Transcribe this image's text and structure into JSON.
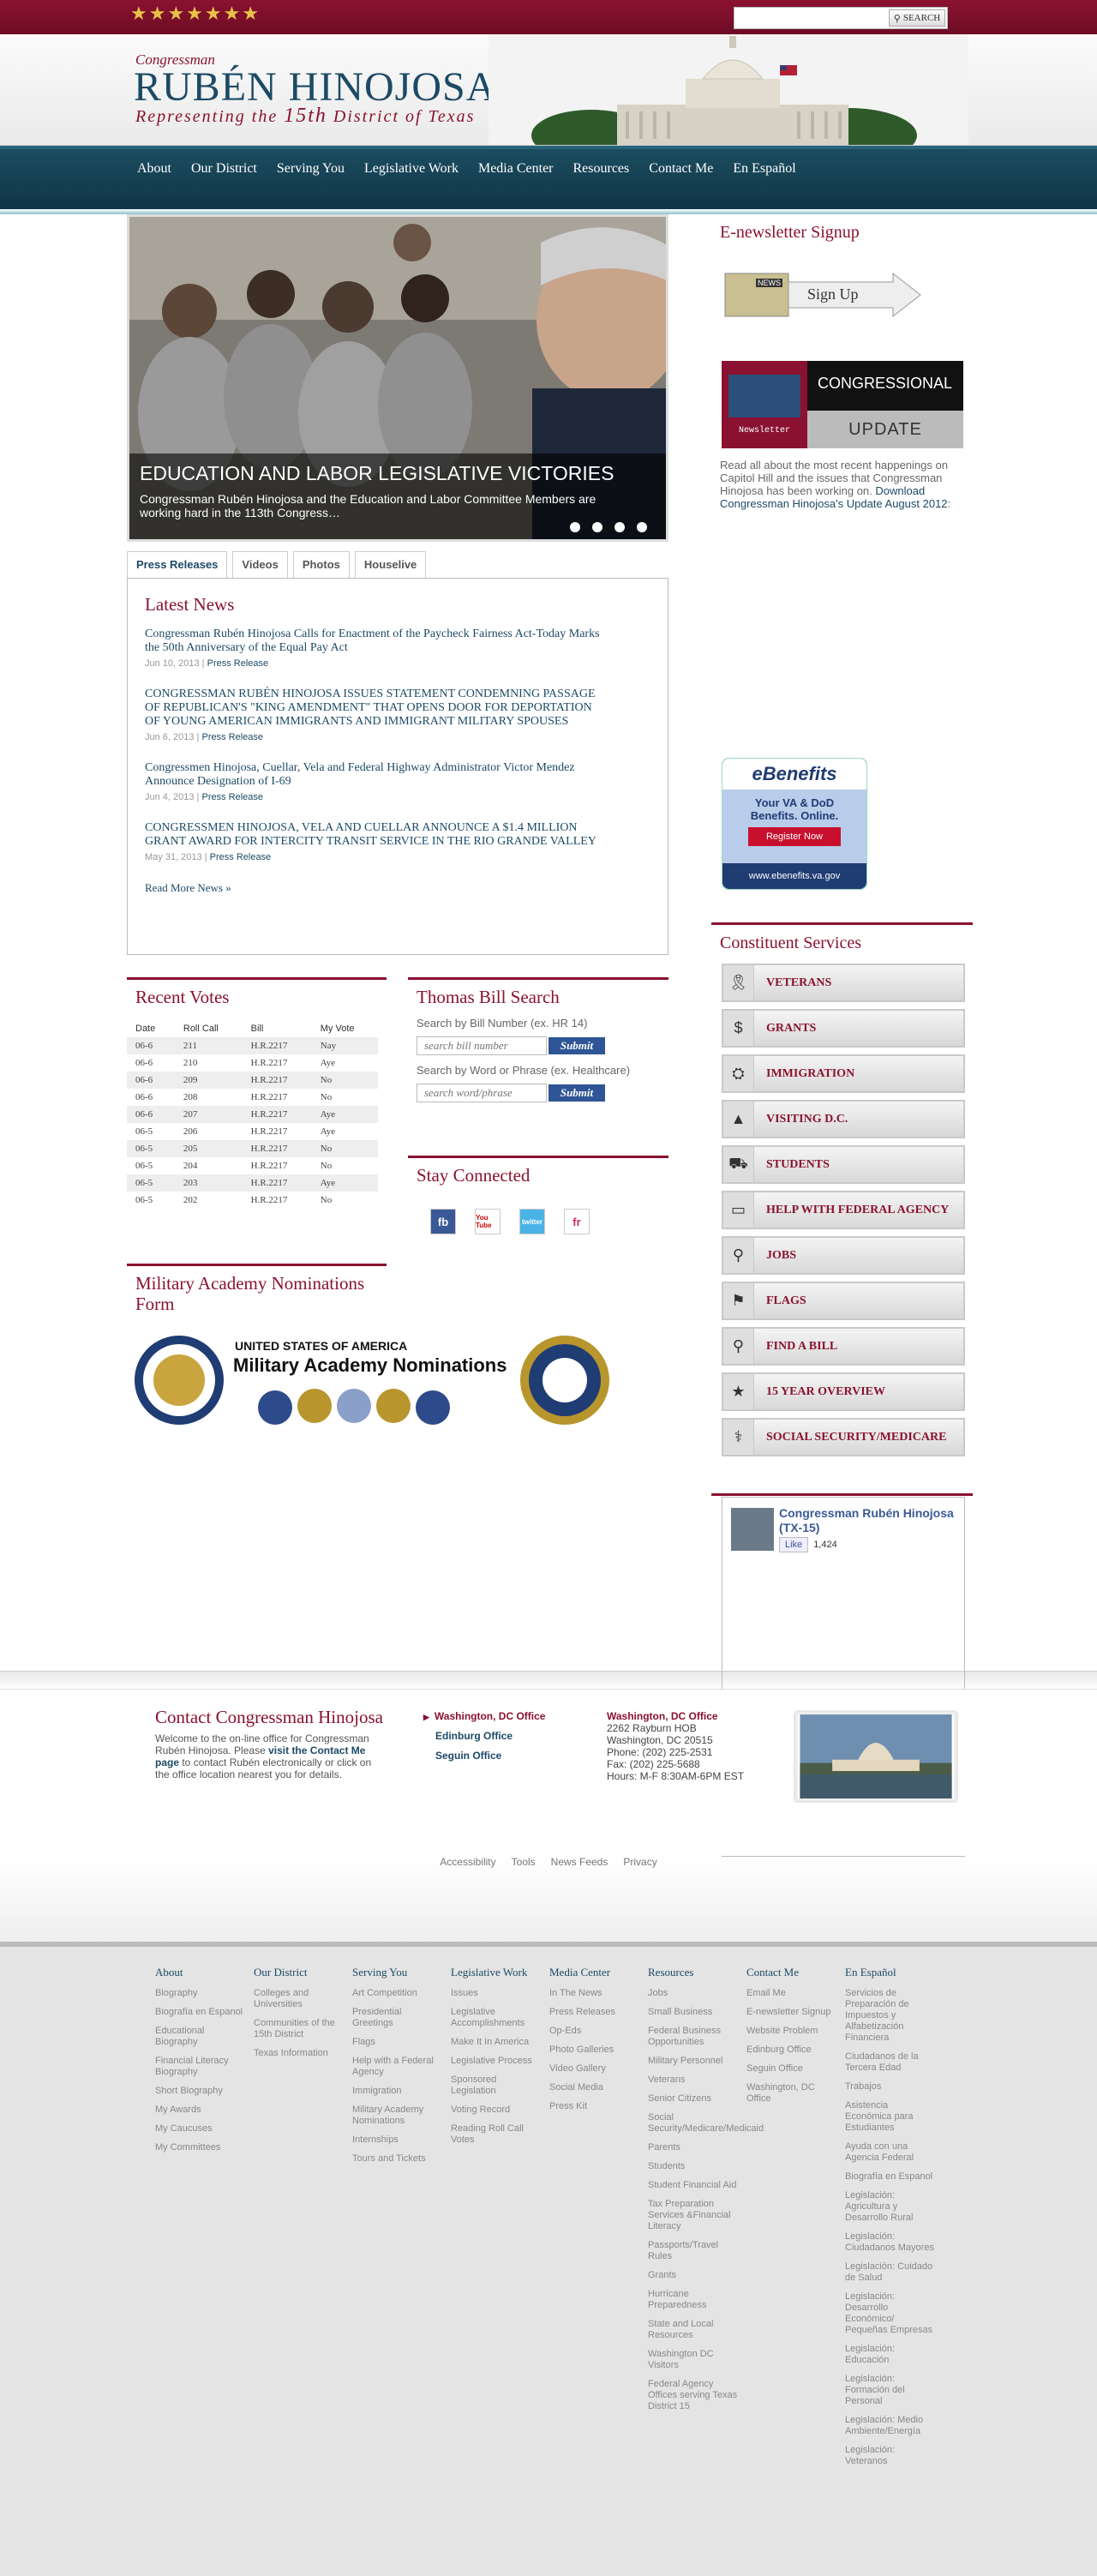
{
  "topbar": {
    "stars": "★★★★★★★",
    "search_placeholder": "",
    "search_label": "SEARCH"
  },
  "header": {
    "small": "Congressman",
    "name": "RUBÉN HINOJOSA",
    "sub_pre": "Representing the ",
    "sub_num": "15th",
    "sub_post": " District of Texas"
  },
  "nav": [
    "About",
    "Our District",
    "Serving You",
    "Legislative Work",
    "Media Center",
    "Resources",
    "Contact Me",
    "En Español"
  ],
  "slider": {
    "title": "EDUCATION AND LABOR LEGISLATIVE VICTORIES",
    "text": "Congressman Rubén Hinojosa and the Education and Labor Committee Members are working hard in the 113th Congress…"
  },
  "tabs": [
    "Press Releases",
    "Videos",
    "Photos",
    "Houselive"
  ],
  "news": {
    "title": "Latest News",
    "items": [
      {
        "title": "Congressman Rubén Hinojosa Calls for Enactment of the Paycheck Fairness Act-Today Marks the 50th Anniversary of the Equal Pay Act",
        "date": "Jun 10, 2013",
        "cat": "Press Release"
      },
      {
        "title": "CONGRESSMAN RUBÉN HINOJOSA ISSUES STATEMENT CONDEMNING PASSAGE OF REPUBLICAN'S \"KING AMENDMENT\" THAT OPENS DOOR FOR DEPORTATION OF YOUNG AMERICAN IMMIGRANTS AND IMMIGRANT MILITARY SPOUSES",
        "date": "Jun 6, 2013",
        "cat": "Press Release"
      },
      {
        "title": "Congressmen Hinojosa, Cuellar, Vela and Federal Highway Administrator Victor Mendez Announce Designation of I-69",
        "date": "Jun 4, 2013",
        "cat": "Press Release"
      },
      {
        "title": "CONGRESSMEN HINOJOSA, VELA AND CUELLAR ANNOUNCE A $1.4 MILLION GRANT AWARD FOR INTERCITY TRANSIT SERVICE IN THE RIO GRANDE VALLEY",
        "date": "May 31, 2013",
        "cat": "Press Release"
      }
    ],
    "more": "Read More News »"
  },
  "votes": {
    "title": "Recent Votes",
    "headers": [
      "Date",
      "Roll Call",
      "Bill",
      "My Vote"
    ],
    "rows": [
      [
        "06-6",
        "211",
        "H.R.2217",
        "Nay"
      ],
      [
        "06-6",
        "210",
        "H.R.2217",
        "Aye"
      ],
      [
        "06-6",
        "209",
        "H.R.2217",
        "No"
      ],
      [
        "06-6",
        "208",
        "H.R.2217",
        "No"
      ],
      [
        "06-6",
        "207",
        "H.R.2217",
        "Aye"
      ],
      [
        "06-5",
        "206",
        "H.R.2217",
        "Aye"
      ],
      [
        "06-5",
        "205",
        "H.R.2217",
        "No"
      ],
      [
        "06-5",
        "204",
        "H.R.2217",
        "No"
      ],
      [
        "06-5",
        "203",
        "H.R.2217",
        "Aye"
      ],
      [
        "06-5",
        "202",
        "H.R.2217",
        "No"
      ]
    ]
  },
  "bill_search": {
    "title": "Thomas Bill Search",
    "label1": "Search by Bill Number (ex. HR 14)",
    "placeholder1": "search bill number",
    "label2": "Search by Word or Phrase (ex. Healthcare)",
    "placeholder2": "search word/phrase",
    "submit": "Submit"
  },
  "stay": {
    "title": "Stay Connected",
    "icons": [
      "fb",
      "You Tube",
      "twitter",
      "fr"
    ]
  },
  "military": {
    "title": "Military Academy Nominations Form",
    "banner1": "UNITED STATES OF AMERICA",
    "banner2": "Military Academy Nominations"
  },
  "sidebar": {
    "signup_title": "E-newsletter Signup",
    "signup_btn": "Sign Up",
    "signup_tag": "NEWS",
    "update1": "CONGRESSIONAL",
    "update2": "UPDATE",
    "update_tag": "Newsletter",
    "update_text": "Read all about the most recent happenings on Capitol Hill and the issues that Congressman Hinojosa has been working on. ",
    "update_link": "Download Congressman Hinojosa's Update August 2012",
    "update_end": ":",
    "eben_logo": "eBenefits",
    "eben_text": "Your VA & DoD Benefits. Online.",
    "eben_btn": "Register Now",
    "eben_url": "www.ebenefits.va.gov",
    "cs_title": "Constituent Services",
    "services": [
      "VETERANS",
      "GRANTS",
      "IMMIGRATION",
      "VISITING D.C.",
      "STUDENTS",
      "HELP WITH FEDERAL AGENCY",
      "JOBS",
      "FLAGS",
      "FIND A BILL",
      "15 YEAR OVERVIEW",
      "SOCIAL SECURITY/MEDICARE"
    ],
    "fb_name": "Congressman Rubén Hinojosa (TX-15)",
    "fb_like": "Like",
    "fb_count": "1,424"
  },
  "contact": {
    "title": "Contact Congressman Hinojosa",
    "text1": "Welcome to the on-line office for Congressman Rubén Hinojosa. Please ",
    "link": "visit the Contact Me page",
    "text2": " to contact Rubén electronically or click on the office location nearest you for details.",
    "offices": [
      "Washington, DC Office",
      "Edinburg Office",
      "Seguin Office"
    ],
    "addr_title": "Washington, DC Office",
    "addr_lines": [
      "2262 Rayburn HOB",
      "Washington, DC 20515",
      "Phone: (202) 225-2531",
      "Fax: (202) 225-5688",
      "Hours: M-F 8:30AM-6PM EST"
    ]
  },
  "footer_links": [
    "Accessibility",
    "Tools",
    "News Feeds",
    "Privacy"
  ],
  "sitemap": [
    {
      "h": "About",
      "items": [
        "Biography",
        "Biografía en Espanol",
        "Educational Biography",
        "Financial Literacy Biography",
        "Short Biography",
        "My Awards",
        "My Caucuses",
        "My Committees"
      ]
    },
    {
      "h": "Our District",
      "items": [
        "Colleges and Universities",
        "Communities of the 15th District",
        "Texas Information"
      ]
    },
    {
      "h": "Serving You",
      "items": [
        "Art Competition",
        "Presidential Greetings",
        "Flags",
        "Help with a Federal Agency",
        "Immigration",
        "Military Academy Nominations",
        "Internships",
        "Tours and Tickets"
      ]
    },
    {
      "h": "Legislative Work",
      "items": [
        "Issues",
        "Legislative Accomplishments",
        "Make It In America",
        "Legislative Process",
        "Sponsored Legislation",
        "Voting Record",
        "Reading Roll Call Votes"
      ]
    },
    {
      "h": "Media Center",
      "items": [
        "In The News",
        "Press Releases",
        "Op-Eds",
        "Photo Galleries",
        "Video Gallery",
        "Social Media",
        "Press Kit"
      ]
    },
    {
      "h": "Resources",
      "items": [
        "Jobs",
        "Small Business",
        "Federal Business Opportunities",
        "Military Personnel",
        "Veterans",
        "Senior Citizens",
        "Social Security/Medicare/Medicaid",
        "Parents",
        "Students",
        "Student Financial Aid",
        "Tax Preparation Services &Financial Literacy",
        "Passports/Travel Rules",
        "Grants",
        "Hurricane Preparedness",
        "State and Local Resources",
        "Washington DC Visitors",
        "Federal Agency Offices serving Texas District 15"
      ]
    },
    {
      "h": "Contact Me",
      "items": [
        "Email Me",
        "E-newsletter Signup",
        "Website Problem",
        "Edinburg Office",
        "Seguin Office",
        "Washington, DC Office"
      ]
    },
    {
      "h": "En Español",
      "items": [
        "Servicios de Preparación de Impuestos y Alfabetización Financiera",
        "Ciudadanos de la Tercera Edad",
        "Trabajos",
        "Asistencia Económica para Estudiantes",
        "Ayuda con una Agencia Federal",
        "Biografía en Espanol",
        "Legislación: Agricultura y Desarrollo Rural",
        "Legislación: Ciudadanos Mayores",
        "Legislación: Cuidado de Salud",
        "Legislación: Desarrollo Económico/ Pequeñas Empresas",
        "Legislación: Educación",
        "Legislación: Formación del Personal",
        "Legislación: Medio Ambiente/Energía",
        "Legislación: Veteranos"
      ]
    }
  ]
}
